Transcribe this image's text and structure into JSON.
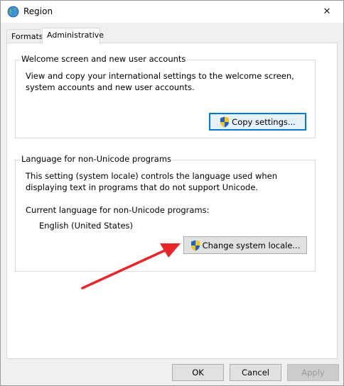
{
  "window": {
    "title": "Region",
    "close_glyph": "✕"
  },
  "tabs": [
    {
      "label": "Formats",
      "active": false
    },
    {
      "label": "Administrative",
      "active": true
    }
  ],
  "welcome_group": {
    "legend": "Welcome screen and new user accounts",
    "description": "View and copy your international settings to the welcome screen, system accounts and new user accounts.",
    "copy_button": "Copy settings..."
  },
  "locale_group": {
    "legend": "Language for non-Unicode programs",
    "description": "This setting (system locale) controls the language used when displaying text in programs that do not support Unicode.",
    "current_label": "Current language for non-Unicode programs:",
    "current_value": "English (United States)",
    "change_button": "Change system locale..."
  },
  "footer": {
    "ok": "OK",
    "cancel": "Cancel",
    "apply": "Apply"
  },
  "colors": {
    "accent": "#0078d7",
    "annotation_arrow": "#e8262a"
  }
}
